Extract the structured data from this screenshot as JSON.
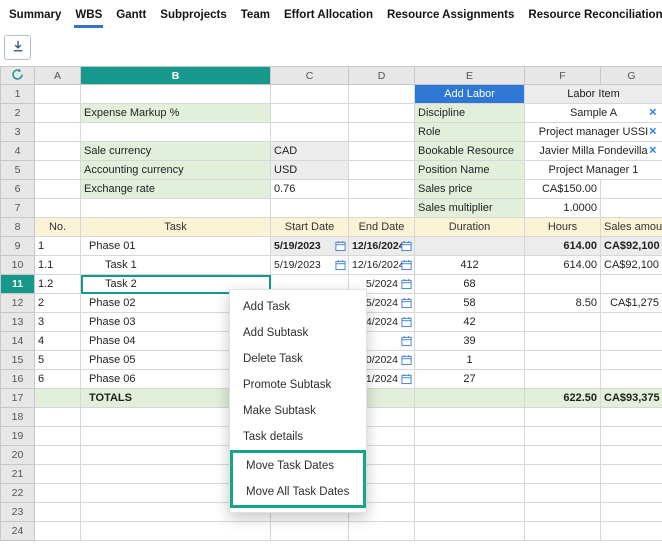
{
  "tabs": {
    "items": [
      {
        "label": "Summary",
        "active": false
      },
      {
        "label": "WBS",
        "active": true
      },
      {
        "label": "Gantt",
        "active": false
      },
      {
        "label": "Subprojects",
        "active": false
      },
      {
        "label": "Team",
        "active": false
      },
      {
        "label": "Effort Allocation",
        "active": false
      },
      {
        "label": "Resource Assignments",
        "active": false
      },
      {
        "label": "Resource Reconciliation",
        "active": false
      }
    ]
  },
  "colors": {
    "accent_teal": "#17988c",
    "tab_active_blue": "#3273c5",
    "add_labor_blue": "#2e77d4",
    "label_green_bg": "#e2efda",
    "header_yellow_bg": "#fbf3d6",
    "computed_gray_bg": "#ececec",
    "highlight_box_green": "#17a589",
    "clear_icon_blue": "#2d7ff0"
  },
  "icons": {
    "clear": "✕"
  },
  "context_menu": {
    "items": [
      "Add Task",
      "Add Subtask",
      "Delete Task",
      "Promote Subtask",
      "Make Subtask",
      "Task details",
      "Move Task Dates",
      "Move All Task Dates"
    ],
    "highlighted": [
      "Move Task Dates",
      "Move All Task Dates"
    ]
  },
  "grid": {
    "column_headers": [
      "A",
      "B",
      "C",
      "D",
      "E",
      "F",
      "G"
    ],
    "selected_column": "B",
    "selected_row": 11,
    "rows": [
      {
        "n": 1,
        "cells": [
          {
            "col": "E",
            "text": "Add Labor",
            "cls": "btnb",
            "name": "add-labor-button"
          },
          {
            "col": "F",
            "span": 2,
            "text": "Labor Item",
            "cls": "gy c"
          }
        ]
      },
      {
        "n": 2,
        "cells": [
          {
            "col": "B",
            "text": "Expense Markup %",
            "cls": "lg"
          },
          {
            "col": "E",
            "text": "Discipline",
            "cls": "lg"
          },
          {
            "col": "F",
            "span": 2,
            "text": "Sample A",
            "cls": "c",
            "clear": true
          }
        ]
      },
      {
        "n": 3,
        "cells": [
          {
            "col": "E",
            "text": "Role",
            "cls": "lg"
          },
          {
            "col": "F",
            "span": 2,
            "text": "Project manager USSI",
            "cls": "c",
            "clear": true
          }
        ]
      },
      {
        "n": 4,
        "cells": [
          {
            "col": "B",
            "text": "Sale currency",
            "cls": "lg"
          },
          {
            "col": "C",
            "text": "CAD",
            "cls": "gy"
          },
          {
            "col": "E",
            "text": "Bookable Resource",
            "cls": "lg"
          },
          {
            "col": "F",
            "span": 2,
            "text": "Javier Milla Fondevilla",
            "cls": "c",
            "clear": true
          }
        ]
      },
      {
        "n": 5,
        "cells": [
          {
            "col": "B",
            "text": "Accounting currency",
            "cls": "lg"
          },
          {
            "col": "C",
            "text": "USD",
            "cls": "gy"
          },
          {
            "col": "E",
            "text": "Position Name",
            "cls": "lg"
          },
          {
            "col": "F",
            "span": 2,
            "text": "Project Manager 1",
            "cls": "c"
          }
        ]
      },
      {
        "n": 6,
        "cells": [
          {
            "col": "B",
            "text": "Exchange rate",
            "cls": "lg"
          },
          {
            "col": "C",
            "text": "0.76",
            "cls": ""
          },
          {
            "col": "E",
            "text": "Sales price",
            "cls": "lg"
          },
          {
            "col": "F",
            "text": "CA$150.00",
            "cls": "r"
          }
        ]
      },
      {
        "n": 7,
        "cells": [
          {
            "col": "E",
            "text": "Sales multiplier",
            "cls": "lg"
          },
          {
            "col": "F",
            "text": "1.0000",
            "cls": "r"
          }
        ]
      },
      {
        "n": 8,
        "cells": [
          {
            "col": "A",
            "text": "No.",
            "cls": "hd"
          },
          {
            "col": "B",
            "text": "Task",
            "cls": "hd"
          },
          {
            "col": "C",
            "text": "Start Date",
            "cls": "hd"
          },
          {
            "col": "D",
            "text": "End Date",
            "cls": "hd"
          },
          {
            "col": "E",
            "text": "Duration",
            "cls": "hd"
          },
          {
            "col": "F",
            "text": "Hours",
            "cls": "hd"
          },
          {
            "col": "G",
            "text": "Sales amount",
            "cls": "hd"
          }
        ]
      },
      {
        "n": 9,
        "cells": [
          {
            "col": "A",
            "text": "1"
          },
          {
            "col": "B",
            "text": "Phase 01",
            "cls": "ind1"
          },
          {
            "col": "C",
            "text": "5/19/2023",
            "cls": "date gy b",
            "icon": "calendar"
          },
          {
            "col": "D",
            "text": "12/16/2024",
            "cls": "date dr gy b",
            "icon": "calendar"
          },
          {
            "col": "E",
            "text": "",
            "cls": "gy"
          },
          {
            "col": "F",
            "text": "614.00",
            "cls": "gy b r"
          },
          {
            "col": "G",
            "text": "CA$92,100",
            "cls": "gy b r"
          }
        ]
      },
      {
        "n": 10,
        "cells": [
          {
            "col": "A",
            "text": "1.1"
          },
          {
            "col": "B",
            "text": "Task 1",
            "cls": "ind2"
          },
          {
            "col": "C",
            "text": "5/19/2023",
            "cls": "date",
            "icon": "calendar"
          },
          {
            "col": "D",
            "text": "12/16/2024",
            "cls": "date dr",
            "icon": "calendar"
          },
          {
            "col": "E",
            "text": "412",
            "cls": "c"
          },
          {
            "col": "F",
            "text": "614.00",
            "cls": "r"
          },
          {
            "col": "G",
            "text": "CA$92,100",
            "cls": "r"
          }
        ]
      },
      {
        "n": 11,
        "cells": [
          {
            "col": "A",
            "text": "1.2"
          },
          {
            "col": "B",
            "text": "Task 2",
            "cls": "ind2 sel"
          },
          {
            "col": "D",
            "text": "5/2024",
            "cls": "date dr",
            "icon": "calendar"
          },
          {
            "col": "E",
            "text": "68",
            "cls": "c"
          }
        ]
      },
      {
        "n": 12,
        "cells": [
          {
            "col": "A",
            "text": "2"
          },
          {
            "col": "B",
            "text": "Phase 02",
            "cls": "ind1"
          },
          {
            "col": "D",
            "text": "5/2024",
            "cls": "date dr",
            "icon": "calendar"
          },
          {
            "col": "E",
            "text": "58",
            "cls": "c"
          },
          {
            "col": "F",
            "text": "8.50",
            "cls": "r"
          },
          {
            "col": "G",
            "text": "CA$1,275",
            "cls": "r"
          }
        ]
      },
      {
        "n": 13,
        "cells": [
          {
            "col": "A",
            "text": "3"
          },
          {
            "col": "B",
            "text": "Phase 03",
            "cls": "ind1"
          },
          {
            "col": "D",
            "text": "4/2024",
            "cls": "date dr",
            "icon": "calendar"
          },
          {
            "col": "E",
            "text": "42",
            "cls": "c"
          }
        ]
      },
      {
        "n": 14,
        "cells": [
          {
            "col": "A",
            "text": "4"
          },
          {
            "col": "B",
            "text": "Phase 04",
            "cls": "ind1"
          },
          {
            "col": "D",
            "text": "",
            "cls": "date dr",
            "icon": "calendar"
          },
          {
            "col": "E",
            "text": "39",
            "cls": "c"
          }
        ]
      },
      {
        "n": 15,
        "cells": [
          {
            "col": "A",
            "text": "5"
          },
          {
            "col": "B",
            "text": "Phase 05",
            "cls": "ind1"
          },
          {
            "col": "D",
            "text": "0/2024",
            "cls": "date dr",
            "icon": "calendar"
          },
          {
            "col": "E",
            "text": "1",
            "cls": "c"
          }
        ]
      },
      {
        "n": 16,
        "cells": [
          {
            "col": "A",
            "text": "6"
          },
          {
            "col": "B",
            "text": "Phase 06",
            "cls": "ind1"
          },
          {
            "col": "D",
            "text": "1/2024",
            "cls": "date dr",
            "icon": "calendar"
          },
          {
            "col": "E",
            "text": "27",
            "cls": "c"
          }
        ]
      },
      {
        "n": 17,
        "cells": [
          {
            "col": "A",
            "text": "",
            "cls": "tot"
          },
          {
            "col": "B",
            "text": "TOTALS",
            "cls": "tot b ind1"
          },
          {
            "col": "C",
            "text": "",
            "cls": "tot"
          },
          {
            "col": "D",
            "text": "",
            "cls": "tot"
          },
          {
            "col": "E",
            "text": "",
            "cls": "tot"
          },
          {
            "col": "F",
            "text": "622.50",
            "cls": "tot b r"
          },
          {
            "col": "G",
            "text": "CA$93,375",
            "cls": "tot b r"
          }
        ]
      },
      {
        "n": 18,
        "cells": []
      },
      {
        "n": 19,
        "cells": []
      },
      {
        "n": 20,
        "cells": []
      },
      {
        "n": 21,
        "cells": []
      },
      {
        "n": 22,
        "cells": []
      },
      {
        "n": 23,
        "cells": []
      },
      {
        "n": 24,
        "cells": []
      }
    ]
  }
}
